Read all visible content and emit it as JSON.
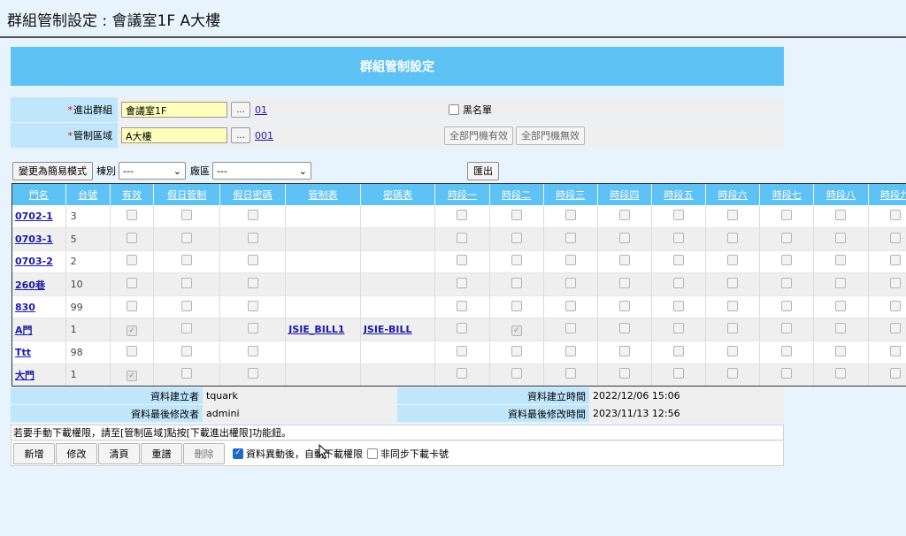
{
  "page": {
    "title": "群組管制設定 : 會議室1F A大樓"
  },
  "banner": {
    "title": "群組管制設定"
  },
  "form": {
    "group": {
      "label": "進出群組",
      "value": "會議室1F",
      "browse": "...",
      "code": "01"
    },
    "area": {
      "label": "管制區域",
      "value": "A大樓",
      "browse": "...",
      "code": "001"
    },
    "blacklist_label": "黑名單",
    "all_valid": "全部門機有效",
    "all_invalid": "全部門機無效"
  },
  "toolbar": {
    "simple_mode": "變更為簡易模式",
    "building_label": "棟別",
    "building_value": "---",
    "zone_label": "廠區",
    "zone_value": "---",
    "export": "匯出"
  },
  "grid": {
    "headers": [
      "門名",
      "台號",
      "有效",
      "假日管制",
      "假日密碼",
      "管制表",
      "密碼表",
      "時段一",
      "時段二",
      "時段三",
      "時段四",
      "時段五",
      "時段六",
      "時段七",
      "時段八",
      "時段九"
    ],
    "rows": [
      {
        "door": "0702-1",
        "num": "3",
        "valid": false,
        "ctrl": "",
        "pwd": "",
        "p2": false
      },
      {
        "door": "0703-1",
        "num": "5",
        "valid": false,
        "ctrl": "",
        "pwd": "",
        "p2": false
      },
      {
        "door": "0703-2",
        "num": "2",
        "valid": false,
        "ctrl": "",
        "pwd": "",
        "p2": false
      },
      {
        "door": "260巷",
        "num": "10",
        "valid": false,
        "ctrl": "",
        "pwd": "",
        "p2": false
      },
      {
        "door": "830",
        "num": "99",
        "valid": false,
        "ctrl": "",
        "pwd": "",
        "p2": false
      },
      {
        "door": "A門",
        "num": "1",
        "valid": true,
        "ctrl": "JSIE_BILL1",
        "pwd": "JSIE-BILL",
        "p2": true
      },
      {
        "door": "Ttt",
        "num": "98",
        "valid": false,
        "ctrl": "",
        "pwd": "",
        "p2": false
      },
      {
        "door": "大門",
        "num": "1",
        "valid": true,
        "ctrl": "",
        "pwd": "",
        "p2": false
      }
    ]
  },
  "info": {
    "creator_label": "資料建立者",
    "creator": "tquark",
    "created_time_label": "資料建立時間",
    "created_time": "2022/12/06 15:06",
    "modifier_label": "資料最後修改者",
    "modifier": "admini",
    "modified_time_label": "資料最後修改時間",
    "modified_time": "2023/11/13 12:56"
  },
  "note": "若要手動下載權限，請至[管制區域]點按[下載進出權限]功能鈕。",
  "actions": {
    "add": "新增",
    "edit": "修改",
    "clear": "清頁",
    "reload": "重譜",
    "delete": "刪除",
    "auto_download": "資料異動後，自動下載權限",
    "async_download": "非同步下載卡號"
  }
}
